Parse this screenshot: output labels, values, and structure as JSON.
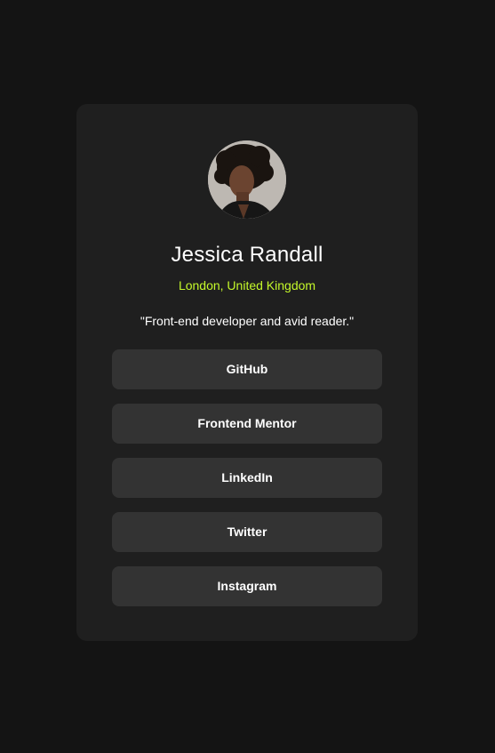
{
  "profile": {
    "name": "Jessica Randall",
    "location": "London, United Kingdom",
    "bio": "\"Front-end developer and avid reader.\""
  },
  "links": [
    {
      "label": "GitHub"
    },
    {
      "label": "Frontend Mentor"
    },
    {
      "label": "LinkedIn"
    },
    {
      "label": "Twitter"
    },
    {
      "label": "Instagram"
    }
  ],
  "colors": {
    "background": "#141414",
    "card": "#1f1f1f",
    "button": "#333333",
    "accent": "#c4f82a",
    "text": "#ffffff"
  }
}
